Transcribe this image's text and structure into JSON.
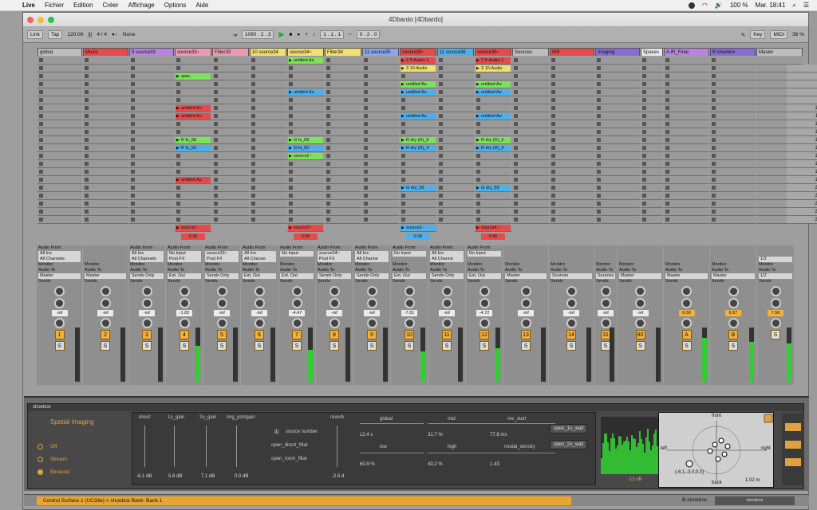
{
  "menubar": {
    "items": [
      "Live",
      "Fichier",
      "Edition",
      "Créer",
      "Affichage",
      "Options",
      "Aide"
    ],
    "battery": "100 %",
    "clock": "Mar. 18:41"
  },
  "window": {
    "title": "4Dbardo  [4Dbardo]"
  },
  "toolbar": {
    "link": "Link",
    "tap": "Tap",
    "tempo": "120.00",
    "signature": "4 / 4",
    "quant": "None",
    "position": "1090 .  2 .  3",
    "loop_start": "1 .  1 .  1",
    "loop_len": "0 .  2 .  0",
    "key": "Key",
    "midi": "MIDI",
    "cpu": "36 %"
  },
  "tracks": [
    {
      "name": "global",
      "color": "#bdbdbd"
    },
    {
      "name": "Music",
      "color": "#e84a4a"
    },
    {
      "name": "9 source33",
      "color": "#b883e0"
    },
    {
      "name": "source33~",
      "color": "#ef9ab0"
    },
    {
      "name": "Filter33",
      "color": "#ef9ab0"
    },
    {
      "name": "10 source34",
      "color": "#f2e06a"
    },
    {
      "name": "source34~",
      "color": "#f2e06a"
    },
    {
      "name": "Filter34",
      "color": "#f2e06a"
    },
    {
      "name": "11 source35",
      "color": "#8aa4f0"
    },
    {
      "name": "source35~",
      "color": "#e84a4a"
    },
    {
      "name": "11 source36",
      "color": "#4ab0ee"
    },
    {
      "name": "source36~",
      "color": "#e84a4a"
    },
    {
      "name": "Sources",
      "color": "#bdbdbd"
    },
    {
      "name": "IR8",
      "color": "#e84a4a"
    },
    {
      "name": "Imaging",
      "color": "#8a6cd8"
    },
    {
      "name": "Spaces",
      "color": "#e8e8e8"
    },
    {
      "name": "A IR_Final",
      "color": "#b883e0"
    },
    {
      "name": "B shoebox",
      "color": "#8a6cd8"
    },
    {
      "name": "Master",
      "color": "#bdbdbd"
    }
  ],
  "clips": [
    {
      "col": 3,
      "row": 2,
      "text": "spec",
      "color": "#7be35a"
    },
    {
      "col": 3,
      "row": 6,
      "text": "untitled Au",
      "color": "#e84a4a"
    },
    {
      "col": 3,
      "row": 7,
      "text": "untitled Au",
      "color": "#e84a4a"
    },
    {
      "col": 3,
      "row": 10,
      "text": "R fx_58",
      "color": "#7be35a"
    },
    {
      "col": 3,
      "row": 11,
      "text": "R fx_50",
      "color": "#4ab0ee"
    },
    {
      "col": 3,
      "row": 15,
      "text": "untitled Au",
      "color": "#e84a4a"
    },
    {
      "col": 6,
      "row": 0,
      "text": "untitled Au",
      "color": "#7be35a"
    },
    {
      "col": 6,
      "row": 4,
      "text": "untitled Au",
      "color": "#4ab0ee"
    },
    {
      "col": 6,
      "row": 10,
      "text": "G fx_58",
      "color": "#7be35a"
    },
    {
      "col": 6,
      "row": 11,
      "text": "G fx_50",
      "color": "#4ab0ee"
    },
    {
      "col": 6,
      "row": 12,
      "text": "source2 -",
      "color": "#7be35a"
    },
    {
      "col": 9,
      "row": 0,
      "text": "2 5-Audio-1",
      "color": "#e84a4a"
    },
    {
      "col": 9,
      "row": 1,
      "text": "3 10-Audio",
      "color": "#f2e06a"
    },
    {
      "col": 9,
      "row": 3,
      "text": "untitled Au",
      "color": "#7be35a"
    },
    {
      "col": 9,
      "row": 4,
      "text": "untitled Au",
      "color": "#4ab0ee"
    },
    {
      "col": 9,
      "row": 7,
      "text": "untitled Au",
      "color": "#4ab0ee"
    },
    {
      "col": 9,
      "row": 10,
      "text": "R dry (D)_5",
      "color": "#7be35a"
    },
    {
      "col": 9,
      "row": 11,
      "text": "R dry (D)_4",
      "color": "#4ab0ee"
    },
    {
      "col": 9,
      "row": 16,
      "text": "G dry_55",
      "color": "#4ab0ee"
    },
    {
      "col": 11,
      "row": 0,
      "text": "2 5-Audio-1",
      "color": "#e84a4a"
    },
    {
      "col": 11,
      "row": 1,
      "text": "3 10-Audio",
      "color": "#f2e06a"
    },
    {
      "col": 11,
      "row": 3,
      "text": "untitled Au",
      "color": "#7be35a"
    },
    {
      "col": 11,
      "row": 4,
      "text": "untitled Au",
      "color": "#4ab0ee"
    },
    {
      "col": 11,
      "row": 7,
      "text": "untitled Au",
      "color": "#4ab0ee"
    },
    {
      "col": 11,
      "row": 10,
      "text": "R dry (D)_5",
      "color": "#7be35a"
    },
    {
      "col": 11,
      "row": 11,
      "text": "R dry (D)_4",
      "color": "#4ab0ee"
    },
    {
      "col": 11,
      "row": 16,
      "text": "G dry_55",
      "color": "#4ab0ee"
    }
  ],
  "scene_numbers": [
    "5",
    "6",
    "7",
    "8",
    "9",
    "10",
    "11",
    "12",
    "13",
    "14",
    "15",
    "16",
    "17",
    "18",
    "19",
    "20",
    "21",
    "22",
    "23",
    "24"
  ],
  "playing": [
    {
      "col": 3,
      "text": "source1 -",
      "color": "#e84a4a",
      "time": "0:36"
    },
    {
      "col": 6,
      "text": "source2 -",
      "color": "#e84a4a",
      "time": "0:36"
    },
    {
      "col": 9,
      "text": "source3 -",
      "color": "#4ab0ee",
      "time": "0:36"
    },
    {
      "col": 11,
      "text": "source4 -",
      "color": "#e84a4a",
      "time": "0:36"
    }
  ],
  "mixer": [
    {
      "from": "All Ins",
      "ch": "All Channels",
      "to": "Master",
      "vol": "-inf",
      "num": "1"
    },
    {
      "from": "",
      "ch": "",
      "to": "Master",
      "vol": "-inf",
      "num": "2"
    },
    {
      "from": "All Ins",
      "ch": "All Channels",
      "to": "Sends Only",
      "vol": "-inf",
      "num": "3"
    },
    {
      "from": "No Input",
      "ch": "Post FX",
      "to": "Ext. Out",
      "vol": "-1.82",
      "num": "4"
    },
    {
      "from": "source33~",
      "ch": "Post FX",
      "to": "Sends Only",
      "vol": "-inf",
      "num": "5"
    },
    {
      "from": "All Ins",
      "ch": "All Channe",
      "to": "Ext. Out",
      "vol": "-inf",
      "num": "6"
    },
    {
      "from": "No Input",
      "ch": "",
      "to": "Ext. Out",
      "vol": "-4.47",
      "num": "7"
    },
    {
      "from": "source34~",
      "ch": "Post FX",
      "to": "Sends Only",
      "vol": "-inf",
      "num": "8"
    },
    {
      "from": "All Ins",
      "ch": "All Channe",
      "to": "Sends Only",
      "vol": "-inf",
      "num": "9"
    },
    {
      "from": "No Input",
      "ch": "",
      "to": "Ext. Out",
      "vol": "-7.81",
      "num": "10"
    },
    {
      "from": "All Ins",
      "ch": "All Channe",
      "to": "Sends Only",
      "vol": "-inf",
      "num": "11"
    },
    {
      "from": "No Input",
      "ch": "",
      "to": "Ext. Out",
      "vol": "-4.72",
      "num": "12"
    },
    {
      "from": "",
      "ch": "",
      "to": "Master",
      "vol": "-inf",
      "num": "13"
    },
    {
      "from": "",
      "ch": "",
      "to": "Sources",
      "vol": "-inf",
      "num": "14"
    },
    {
      "from": "",
      "ch": "",
      "to": "Sources",
      "vol": "-inf",
      "num": "31"
    },
    {
      "from": "",
      "ch": "",
      "to": "Master",
      "vol": "-inf",
      "num": "80"
    },
    {
      "from": "",
      "ch": "",
      "to": "Master",
      "vol": "9.50",
      "num": "A"
    },
    {
      "from": "",
      "ch": "",
      "to": "Master",
      "vol": "6.67",
      "num": "B"
    },
    {
      "from": "",
      "ch": "1/2",
      "to": "1/2",
      "vol": "7.56",
      "num": ""
    }
  ],
  "labels": {
    "midi_from": "MIDI From",
    "audio_from": "Audio From",
    "monitor": "Monitor",
    "audio_to": "Audio To",
    "sends": "Sends",
    "in": "In",
    "auto": "Auto",
    "off": "Off",
    "cue_out": "Cue Out",
    "master_out": "Master Out"
  },
  "device": {
    "track_title": "shoebox",
    "title": "Spatial imaging",
    "modes": [
      "Off",
      "Stream",
      "Binaural"
    ],
    "direct": "direct",
    "g1": "1o_gain",
    "g2": "2o_gain",
    "gpost": "img_postgain",
    "v_direct": "-6.1 dB",
    "v_g1": "5.8 dB",
    "v_g2": "7.1 dB",
    "v_post": "0.0 dB",
    "src_num": "1",
    "src_label": "source number",
    "open_direct": "open_direct_filtar",
    "open_room": "open_room_filtar",
    "reverb": "reverb",
    "v_reverb": "-2.5 d",
    "global": "global",
    "v_global": "12.4 s",
    "mid": "mid",
    "v_mid": "31.7 %",
    "rev_start": "rev_start",
    "v_rev_start": "77.8 ms",
    "low": "low",
    "v_low": "60.9 %",
    "high": "high",
    "v_high": "43.2 %",
    "modal": "modal_density",
    "v_modal": "1.43",
    "wall1": "open_1o_wall",
    "wall2": "open_2o_wall",
    "spec_db": "-13 dB",
    "front": "front",
    "back": "back",
    "left": "left",
    "right": "right",
    "coord": "(-6.1,-3.0,0.0)",
    "dist": "1.02 m"
  },
  "status": {
    "text": "Control Surface 1 (UC33e) > shoebox Bank: Bank 1",
    "right": "B-shoebox",
    "right2": "shoebox"
  }
}
